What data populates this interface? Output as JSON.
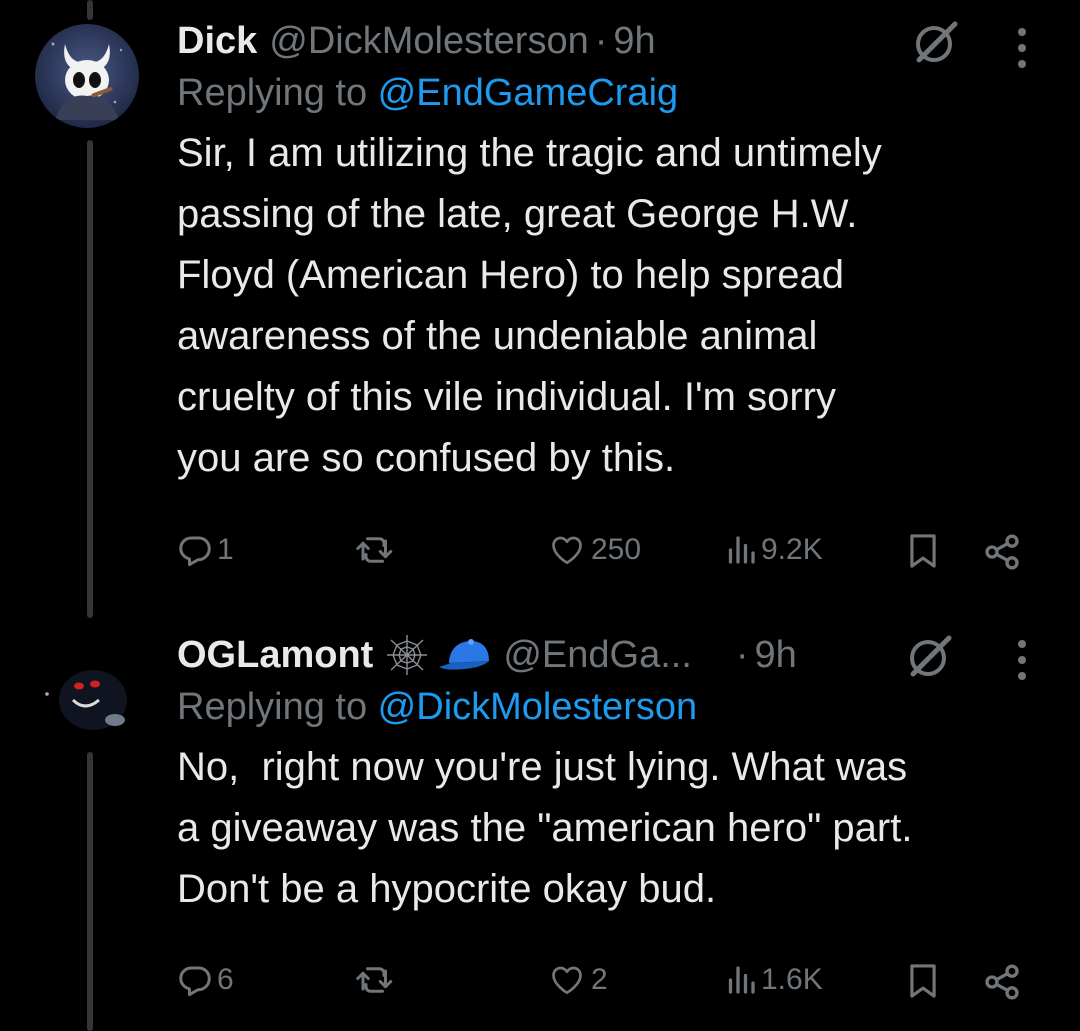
{
  "tweets": [
    {
      "name": "Dick",
      "handle": "@DickMolesterson",
      "separator": "·",
      "time": "9h",
      "replying_prefix": "Replying to ",
      "replying_handle": "@EndGameCraig",
      "text": "Sir, I am utilizing the tragic and untimely\npassing of the late, great George H.W.\nFloyd (American Hero) to help spread\nawareness of the undeniable animal\ncruelty of this vile individual. I'm sorry\nyou are so confused by this.",
      "replies": "1",
      "reposts": "",
      "likes": "250",
      "views": "9.2K"
    },
    {
      "name": "OGLamont",
      "badges": [
        "spiderweb-icon",
        "blue-cap-icon"
      ],
      "handle": "@EndGa...",
      "separator": "·",
      "time": "9h",
      "replying_prefix": "Replying to ",
      "replying_handle": "@DickMolesterson",
      "text": "No,  right now you're just lying. What was\na giveaway was the \"american hero\" part.\nDon't be a hypocrite okay bud.",
      "replies": "6",
      "reposts": "",
      "likes": "2",
      "views": "1.6K"
    }
  ],
  "colors": {
    "background": "#000000",
    "text": "#e7e9ea",
    "secondary": "#71767b",
    "link": "#1d9bf0",
    "thread_line": "#333639"
  }
}
